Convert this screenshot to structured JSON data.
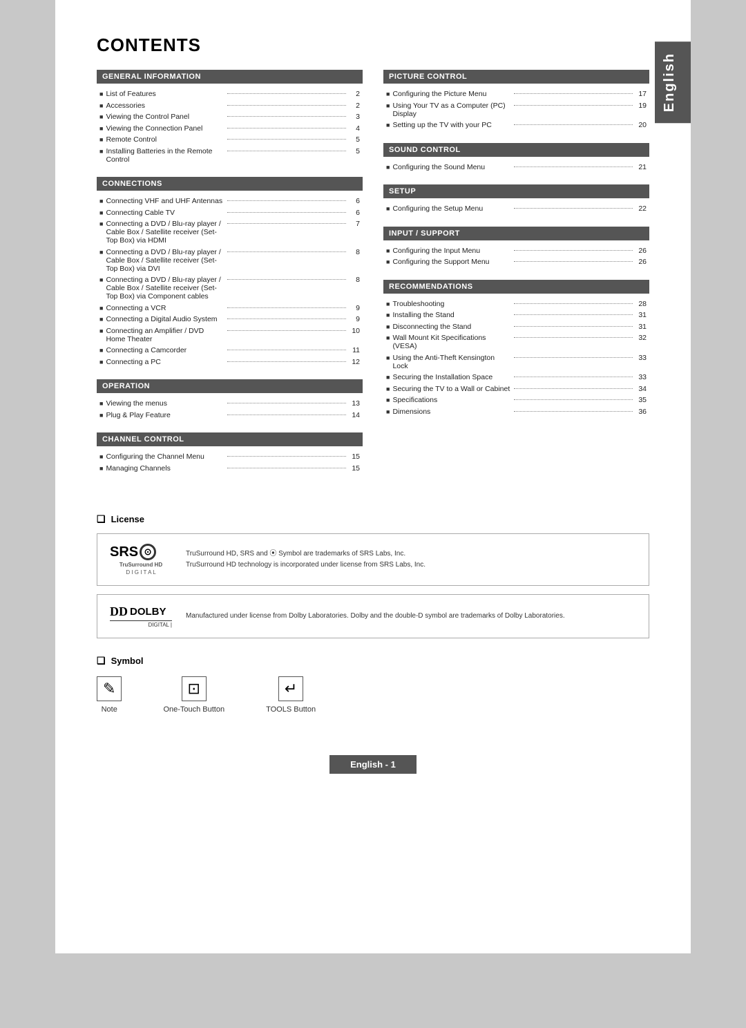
{
  "page": {
    "title": "CONTENTS",
    "side_tab": "English",
    "footer": "English - 1"
  },
  "sections_left": [
    {
      "header": "GENERAL INFORMATION",
      "items": [
        {
          "text": "List of Features",
          "page": "2"
        },
        {
          "text": "Accessories",
          "page": "2"
        },
        {
          "text": "Viewing the Control Panel",
          "page": "3"
        },
        {
          "text": "Viewing the Connection Panel",
          "page": "4"
        },
        {
          "text": "Remote Control",
          "page": "5"
        },
        {
          "text": "Installing Batteries in the Remote Control",
          "page": "5"
        }
      ]
    },
    {
      "header": "CONNECTIONS",
      "items": [
        {
          "text": "Connecting VHF and UHF Antennas",
          "page": "6"
        },
        {
          "text": "Connecting Cable TV",
          "page": "6"
        },
        {
          "text": "Connecting a DVD / Blu-ray player / Cable Box / Satellite receiver (Set-Top Box) via HDMI",
          "page": "7"
        },
        {
          "text": "Connecting a DVD / Blu-ray player / Cable Box / Satellite receiver (Set-Top Box) via DVI",
          "page": "8"
        },
        {
          "text": "Connecting a DVD / Blu-ray player / Cable Box / Satellite receiver (Set-Top Box) via Component cables",
          "page": "8"
        },
        {
          "text": "Connecting a VCR",
          "page": "9"
        },
        {
          "text": "Connecting a Digital Audio System",
          "page": "9"
        },
        {
          "text": "Connecting an Amplifier / DVD Home Theater",
          "page": "10"
        },
        {
          "text": "Connecting a Camcorder",
          "page": "11"
        },
        {
          "text": "Connecting a PC",
          "page": "12"
        }
      ]
    },
    {
      "header": "OPERATION",
      "items": [
        {
          "text": "Viewing the menus",
          "page": "13"
        },
        {
          "text": "Plug & Play Feature",
          "page": "14"
        }
      ]
    },
    {
      "header": "CHANNEL CONTROL",
      "items": [
        {
          "text": "Configuring the Channel Menu",
          "page": "15"
        },
        {
          "text": "Managing Channels",
          "page": "15"
        }
      ]
    }
  ],
  "sections_right": [
    {
      "header": "PICTURE CONTROL",
      "items": [
        {
          "text": "Configuring the Picture Menu",
          "page": "17"
        },
        {
          "text": "Using Your TV as a Computer (PC) Display",
          "page": "19"
        },
        {
          "text": "Setting up the TV with your PC",
          "page": "20"
        }
      ]
    },
    {
      "header": "SOUND CONTROL",
      "items": [
        {
          "text": "Configuring the Sound Menu",
          "page": "21"
        }
      ]
    },
    {
      "header": "SETUP",
      "items": [
        {
          "text": "Configuring the Setup Menu",
          "page": "22"
        }
      ]
    },
    {
      "header": "INPUT / SUPPORT",
      "items": [
        {
          "text": "Configuring the Input Menu",
          "page": "26"
        },
        {
          "text": "Configuring the Support Menu",
          "page": "26"
        }
      ]
    },
    {
      "header": "RECOMMENDATIONS",
      "items": [
        {
          "text": "Troubleshooting",
          "page": "28"
        },
        {
          "text": "Installing the Stand",
          "page": "31"
        },
        {
          "text": "Disconnecting the Stand",
          "page": "31"
        },
        {
          "text": "Wall Mount Kit Specifications (VESA)",
          "page": "32"
        },
        {
          "text": "Using the Anti-Theft Kensington Lock",
          "page": "33"
        },
        {
          "text": "Securing the Installation Space",
          "page": "33"
        },
        {
          "text": "Securing the TV to a Wall or Cabinet",
          "page": "34"
        },
        {
          "text": "Specifications",
          "page": "35"
        },
        {
          "text": "Dimensions",
          "page": "36"
        }
      ]
    }
  ],
  "license": {
    "title": "License",
    "srs": {
      "brand": "SRS",
      "product": "TruSurround HD",
      "sub": "D I G I T A L",
      "text1": "TruSurround HD, SRS and ⦿ Symbol are trademarks of SRS Labs, Inc.",
      "text2": "TruSurround HD technology is incorporated under license from SRS Labs, Inc."
    },
    "dolby": {
      "brand": "DOLBY",
      "sub": "DIGITAL",
      "text": "Manufactured under license from Dolby Laboratories. Dolby and the double-D symbol are trademarks of Dolby Laboratories."
    }
  },
  "symbol": {
    "title": "Symbol",
    "items": [
      {
        "icon": "✎",
        "label": "Note"
      },
      {
        "icon": "⊡",
        "label": "One-Touch Button"
      },
      {
        "icon": "↵",
        "label": "TOOLS Button"
      }
    ]
  }
}
